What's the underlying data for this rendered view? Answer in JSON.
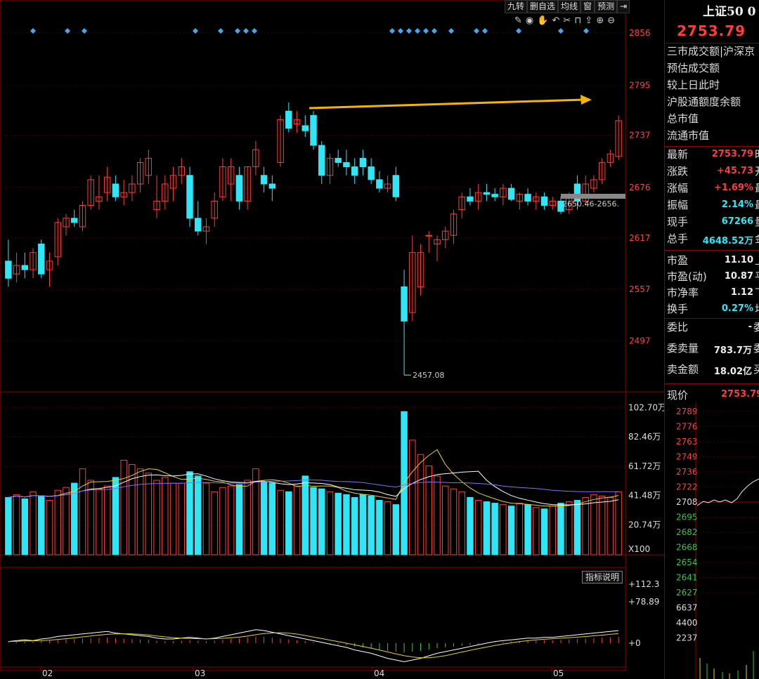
{
  "toolbar": {
    "items": [
      "九转",
      "删自选",
      "均线",
      "窗",
      "预测",
      "⇥"
    ]
  },
  "ticker": {
    "name": "上证50 0",
    "price": "2753.79"
  },
  "price_axis": [
    "2856",
    "2795",
    "2737",
    "2676",
    "2617",
    "2557",
    "2497"
  ],
  "volume_axis": [
    "102.70万",
    "82.46万",
    "61.72万",
    "41.48万",
    "20.74万",
    "X100"
  ],
  "indicator_axis": [
    "+112.3",
    "+78.89",
    "+0"
  ],
  "date_axis": [
    "02",
    "03",
    "04",
    "05"
  ],
  "annotations": {
    "low": "2457.08",
    "range": "2650.46-2656."
  },
  "indicator_button": "指标说明",
  "info_rows": [
    {
      "label": "三市成交额|沪深京",
      "value": ""
    },
    {
      "label": "预估成交额",
      "value": ""
    },
    {
      "label": "较上日此时",
      "value": ""
    },
    {
      "label": "沪股通额度余额",
      "value": ""
    },
    {
      "label": "总市值",
      "value": ""
    },
    {
      "label": "流通市值",
      "value": ""
    }
  ],
  "quote_rows": [
    {
      "label": "最新",
      "value": "2753.79",
      "tail": "时",
      "color": "red"
    },
    {
      "label": "涨跌",
      "value": "+45.73",
      "tail": "开",
      "color": "red"
    },
    {
      "label": "涨幅",
      "value": "+1.69%",
      "tail": "最",
      "color": "red"
    },
    {
      "label": "振幅",
      "value": "2.14%",
      "tail": "最",
      "color": "cyan"
    },
    {
      "label": "现手",
      "value": "67266",
      "tail": "量",
      "color": "cyan"
    },
    {
      "label": "总手",
      "value": "4648.52万",
      "tail": "金",
      "color": "cyan"
    }
  ],
  "ratio_rows": [
    {
      "label": "市盈",
      "value": "11.10",
      "tail": "上",
      "color": "white"
    },
    {
      "label": "市盈(动)",
      "value": "10.87",
      "tail": "平",
      "color": "white"
    },
    {
      "label": "市净率",
      "value": "1.12",
      "tail": "下",
      "color": "white"
    },
    {
      "label": "换手",
      "value": "0.27%",
      "tail": "均",
      "color": "cyan"
    }
  ],
  "order_rows": [
    {
      "label": "委比",
      "value": "-",
      "tail": "委",
      "color": "white"
    },
    {
      "label": "委卖量",
      "value": "783.7万",
      "tail": "委",
      "color": "white"
    },
    {
      "label": "卖金额",
      "value": "18.02亿",
      "tail": "买",
      "color": "white"
    }
  ],
  "current_price": {
    "label": "现价",
    "value": "2753.79"
  },
  "mini_price_axis": [
    "2789",
    "2776",
    "2763",
    "2749",
    "2736",
    "2722",
    "2708",
    "2695",
    "2682",
    "2668",
    "2654",
    "2641",
    "2627",
    "6637",
    "4400",
    "2237"
  ],
  "colors": {
    "up": "#ff3b3b",
    "down": "#2ee6f5",
    "ma_yellow": "#e6d21e",
    "ma_white": "#ffffff",
    "ma_purple": "#8a6cff",
    "arrow": "#f5b400"
  },
  "chart_data": {
    "type": "candlestick",
    "ylim": [
      2440,
      2870
    ],
    "candles": [
      [
        2590,
        2615,
        2560,
        2570
      ],
      [
        2575,
        2600,
        2565,
        2585
      ],
      [
        2585,
        2600,
        2570,
        2580
      ],
      [
        2580,
        2605,
        2570,
        2600
      ],
      [
        2610,
        2615,
        2570,
        2575
      ],
      [
        2580,
        2600,
        2560,
        2590
      ],
      [
        2595,
        2640,
        2585,
        2635
      ],
      [
        2630,
        2645,
        2620,
        2640
      ],
      [
        2640,
        2650,
        2630,
        2635
      ],
      [
        2630,
        2660,
        2625,
        2655
      ],
      [
        2655,
        2690,
        2650,
        2685
      ],
      [
        2660,
        2690,
        2650,
        2665
      ],
      [
        2670,
        2700,
        2660,
        2688
      ],
      [
        2680,
        2690,
        2660,
        2665
      ],
      [
        2665,
        2685,
        2655,
        2670
      ],
      [
        2670,
        2690,
        2660,
        2680
      ],
      [
        2680,
        2710,
        2670,
        2705
      ],
      [
        2690,
        2720,
        2680,
        2710
      ],
      [
        2650,
        2690,
        2640,
        2660
      ],
      [
        2660,
        2690,
        2650,
        2680
      ],
      [
        2675,
        2700,
        2660,
        2690
      ],
      [
        2690,
        2710,
        2680,
        2700
      ],
      [
        2690,
        2700,
        2630,
        2640
      ],
      [
        2640,
        2660,
        2620,
        2625
      ],
      [
        2625,
        2640,
        2610,
        2630
      ],
      [
        2640,
        2670,
        2630,
        2660
      ],
      [
        2665,
        2710,
        2660,
        2700
      ],
      [
        2680,
        2710,
        2660,
        2700
      ],
      [
        2690,
        2700,
        2650,
        2660
      ],
      [
        2660,
        2700,
        2650,
        2700
      ],
      [
        2700,
        2730,
        2690,
        2720
      ],
      [
        2690,
        2700,
        2670,
        2680
      ],
      [
        2680,
        2690,
        2660,
        2675
      ],
      [
        2705,
        2760,
        2700,
        2755
      ],
      [
        2765,
        2775,
        2740,
        2745
      ],
      [
        2750,
        2765,
        2740,
        2755
      ],
      [
        2748,
        2760,
        2735,
        2742
      ],
      [
        2760,
        2765,
        2720,
        2725
      ],
      [
        2725,
        2730,
        2680,
        2690
      ],
      [
        2690,
        2715,
        2680,
        2710
      ],
      [
        2710,
        2720,
        2700,
        2705
      ],
      [
        2705,
        2720,
        2690,
        2700
      ],
      [
        2700,
        2710,
        2680,
        2690
      ],
      [
        2710,
        2720,
        2690,
        2700
      ],
      [
        2700,
        2710,
        2680,
        2685
      ],
      [
        2685,
        2695,
        2670,
        2675
      ],
      [
        2675,
        2690,
        2670,
        2680
      ],
      [
        2690,
        2700,
        2660,
        2665
      ],
      [
        2560,
        2580,
        2457.08,
        2520
      ],
      [
        2530,
        2620,
        2520,
        2600
      ],
      [
        2560,
        2610,
        2550,
        2600
      ],
      [
        2620,
        2625,
        2600,
        2620
      ],
      [
        2610,
        2620,
        2590,
        2615
      ],
      [
        2615,
        2630,
        2605,
        2625
      ],
      [
        2620,
        2650,
        2610,
        2645
      ],
      [
        2650,
        2670,
        2640,
        2665
      ],
      [
        2665,
        2675,
        2655,
        2660
      ],
      [
        2660,
        2680,
        2650,
        2670
      ],
      [
        2670,
        2680,
        2660,
        2668
      ],
      [
        2668,
        2675,
        2660,
        2665
      ],
      [
        2665,
        2680,
        2655,
        2675
      ],
      [
        2675,
        2680,
        2660,
        2662
      ],
      [
        2660,
        2670,
        2650,
        2668
      ],
      [
        2668,
        2675,
        2655,
        2660
      ],
      [
        2660,
        2670,
        2650,
        2665
      ],
      [
        2665,
        2670,
        2650,
        2655
      ],
      [
        2655,
        2665,
        2650,
        2660
      ],
      [
        2660,
        2665,
        2645,
        2648
      ],
      [
        2650,
        2670,
        2645,
        2665
      ],
      [
        2680,
        2690,
        2650,
        2660
      ],
      [
        2660,
        2690,
        2655,
        2680
      ],
      [
        2675,
        2690,
        2670,
        2685
      ],
      [
        2685,
        2710,
        2680,
        2705
      ],
      [
        2705,
        2720,
        2700,
        2715
      ],
      [
        2712,
        2760,
        2708,
        2753.79
      ]
    ],
    "volume": [
      40,
      42,
      39,
      44,
      41,
      38,
      45,
      47,
      50,
      60,
      52,
      46,
      48,
      54,
      66,
      63,
      60,
      57,
      52,
      54,
      50,
      50,
      58,
      55,
      50,
      44,
      47,
      48,
      49,
      52,
      60,
      51,
      50,
      45,
      44,
      48,
      55,
      47,
      46,
      44,
      43,
      42,
      40,
      42,
      41,
      38,
      37,
      35,
      100,
      80,
      70,
      62,
      55,
      48,
      46,
      44,
      40,
      38,
      37,
      36,
      35,
      34,
      36,
      35,
      33,
      32,
      34,
      36,
      37,
      38,
      40,
      42,
      41,
      40,
      44
    ],
    "macd": [
      2,
      3,
      4,
      3,
      5,
      6,
      8,
      9,
      10,
      11,
      12,
      13,
      14,
      12,
      11,
      10,
      9,
      8,
      6,
      5,
      5,
      6,
      7,
      6,
      5,
      6,
      8,
      10,
      12,
      14,
      16,
      15,
      13,
      11,
      9,
      7,
      5,
      3,
      1,
      -1,
      -3,
      -5,
      -8,
      -10,
      -12,
      -15,
      -18,
      -20,
      -22,
      -20,
      -18,
      -15,
      -12,
      -10,
      -8,
      -6,
      -4,
      -2,
      0,
      2,
      3,
      4,
      5,
      6,
      6,
      7,
      7,
      8,
      9,
      10,
      11,
      12,
      13,
      14,
      15
    ]
  }
}
